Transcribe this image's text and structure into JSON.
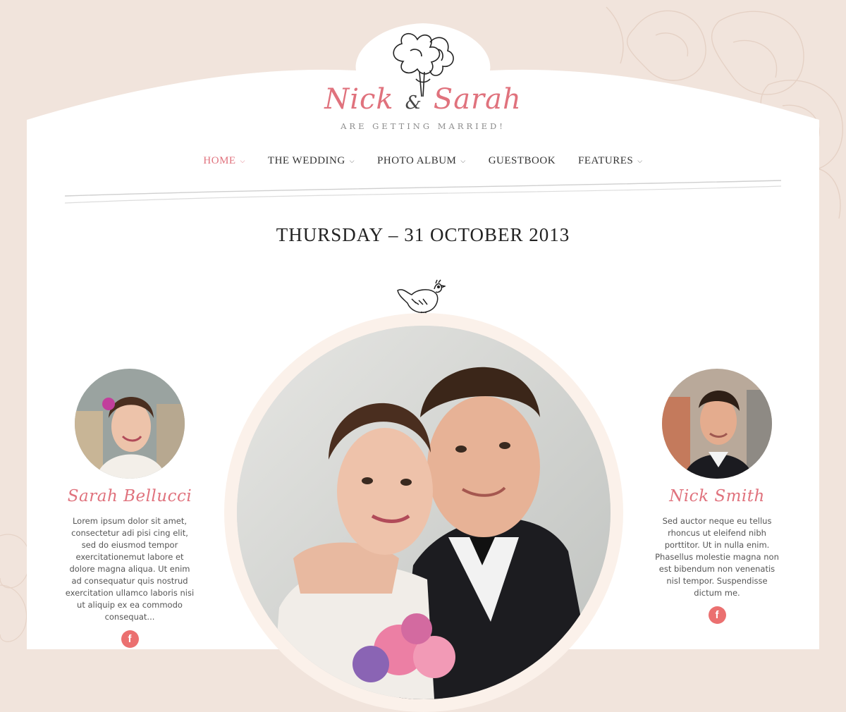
{
  "header": {
    "groom": "Nick",
    "ampersand": "&",
    "bride": "Sarah",
    "tagline": "ARE GETTING MARRIED!"
  },
  "nav": {
    "items": [
      {
        "label": "HOME",
        "has_dropdown": true,
        "active": true
      },
      {
        "label": "THE WEDDING",
        "has_dropdown": true,
        "active": false
      },
      {
        "label": "PHOTO ALBUM",
        "has_dropdown": true,
        "active": false
      },
      {
        "label": "GUESTBOOK",
        "has_dropdown": false,
        "active": false
      },
      {
        "label": "FEATURES",
        "has_dropdown": true,
        "active": false
      }
    ]
  },
  "date": "THURSDAY – 31 OCTOBER 2013",
  "bride_profile": {
    "name": "Sarah Bellucci",
    "bio": "Lorem ipsum dolor sit amet, consectetur adi pisi cing elit, sed do eiusmod tempor exercitationemut labore et dolore magna aliqua. Ut enim ad consequatur quis nostrud exercitation ullamco laboris nisi ut aliquip ex ea commodo consequat...",
    "social_icon": "facebook-icon",
    "social_glyph": "f"
  },
  "groom_profile": {
    "name": "Nick Smith",
    "bio": "Sed auctor neque eu tellus rhoncus ut eleifend nibh porttitor. Ut in nulla enim. Phasellus molestie magna non est bibendum non venenatis nisl tempor. Suspendisse dictum me.",
    "social_icon": "facebook-icon",
    "social_glyph": "f"
  },
  "colors": {
    "accent": "#e0727d",
    "background": "#f1e4dc",
    "card": "#ffffff",
    "text": "#333333",
    "social": "#eb7070"
  }
}
